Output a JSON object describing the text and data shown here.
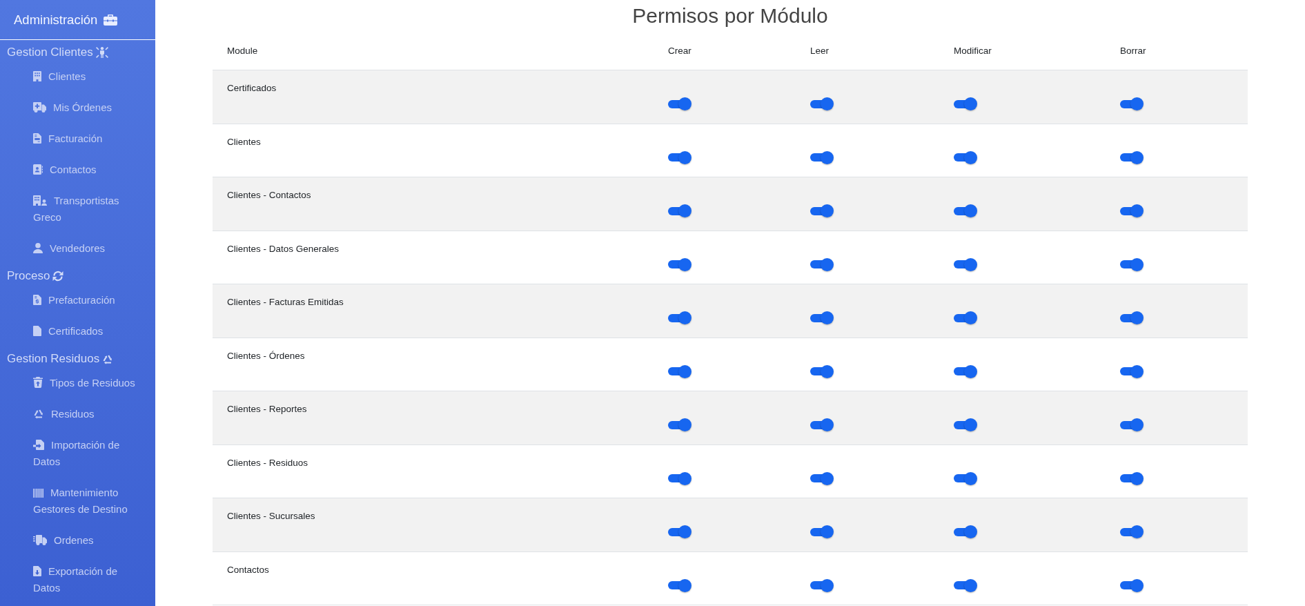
{
  "sidebar": {
    "title": "Administración",
    "sections": [
      {
        "title": "Gestion Clientes",
        "items": [
          "Clientes",
          "Mis Órdenes",
          "Facturación",
          "Contactos",
          "Transportistas Greco",
          "Vendedores"
        ]
      },
      {
        "title": "Proceso",
        "items": [
          "Prefacturación",
          "Certificados"
        ]
      },
      {
        "title": "Gestion Residuos",
        "items": [
          "Tipos de Residuos",
          "Residuos",
          "Importación de Datos",
          "Mantenimiento Gestores de Destino",
          "Ordenes",
          "Exportación de Datos"
        ]
      }
    ]
  },
  "main": {
    "title": "Permisos por Módulo"
  },
  "table": {
    "columns": [
      "Module",
      "Crear",
      "Leer",
      "Modificar",
      "Borrar"
    ],
    "rows": [
      {
        "module": "Certificados",
        "permissions": [
          {
            "on": true
          },
          {
            "on": true
          },
          {
            "on": true
          },
          {
            "on": true
          }
        ]
      },
      {
        "module": "Clientes",
        "permissions": [
          {
            "on": true
          },
          {
            "on": true
          },
          {
            "on": true
          },
          {
            "on": true
          }
        ]
      },
      {
        "module": "Clientes - Contactos",
        "permissions": [
          {
            "on": true
          },
          {
            "on": true
          },
          {
            "on": true
          },
          {
            "on": true
          }
        ]
      },
      {
        "module": "Clientes - Datos Generales",
        "permissions": [
          {
            "on": true
          },
          {
            "on": true
          },
          {
            "on": true
          },
          {
            "on": true
          }
        ]
      },
      {
        "module": "Clientes - Facturas Emitidas",
        "permissions": [
          {
            "on": true
          },
          {
            "on": true
          },
          {
            "on": true
          },
          {
            "on": true
          }
        ]
      },
      {
        "module": "Clientes - Órdenes",
        "permissions": [
          {
            "on": true
          },
          {
            "on": true
          },
          {
            "on": true
          },
          {
            "on": true
          }
        ]
      },
      {
        "module": "Clientes - Reportes",
        "permissions": [
          {
            "on": true
          },
          {
            "on": true
          },
          {
            "on": true
          },
          {
            "on": true
          }
        ]
      },
      {
        "module": "Clientes - Residuos",
        "permissions": [
          {
            "on": true
          },
          {
            "on": true
          },
          {
            "on": true
          },
          {
            "on": true
          }
        ]
      },
      {
        "module": "Clientes - Sucursales",
        "permissions": [
          {
            "on": true
          },
          {
            "on": true
          },
          {
            "on": true
          },
          {
            "on": true
          }
        ]
      },
      {
        "module": "Contactos",
        "permissions": [
          {
            "on": true
          },
          {
            "on": true
          },
          {
            "on": true
          },
          {
            "on": true
          }
        ]
      }
    ]
  }
}
